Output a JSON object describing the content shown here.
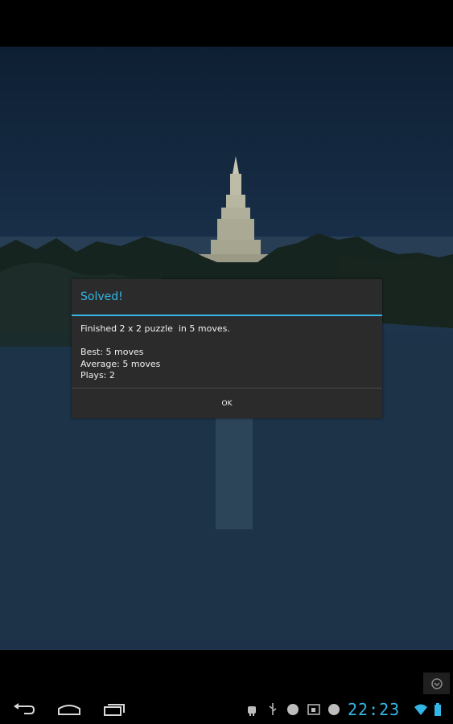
{
  "dialog": {
    "title": "Solved!",
    "message": "Finished 2 x 2 puzzle  in 5 moves.\n\nBest: 5 moves\nAverage: 5 moves\nPlays: 2",
    "ok_label": "OK"
  },
  "status_bar": {
    "time": "22:23"
  },
  "colors": {
    "accent": "#33b5e5",
    "dialog_bg": "#2b2b2b"
  },
  "icons": {
    "back": "back-icon",
    "home": "home-icon",
    "recents": "recent-apps-icon",
    "menu": "menu-overflow-icon"
  }
}
